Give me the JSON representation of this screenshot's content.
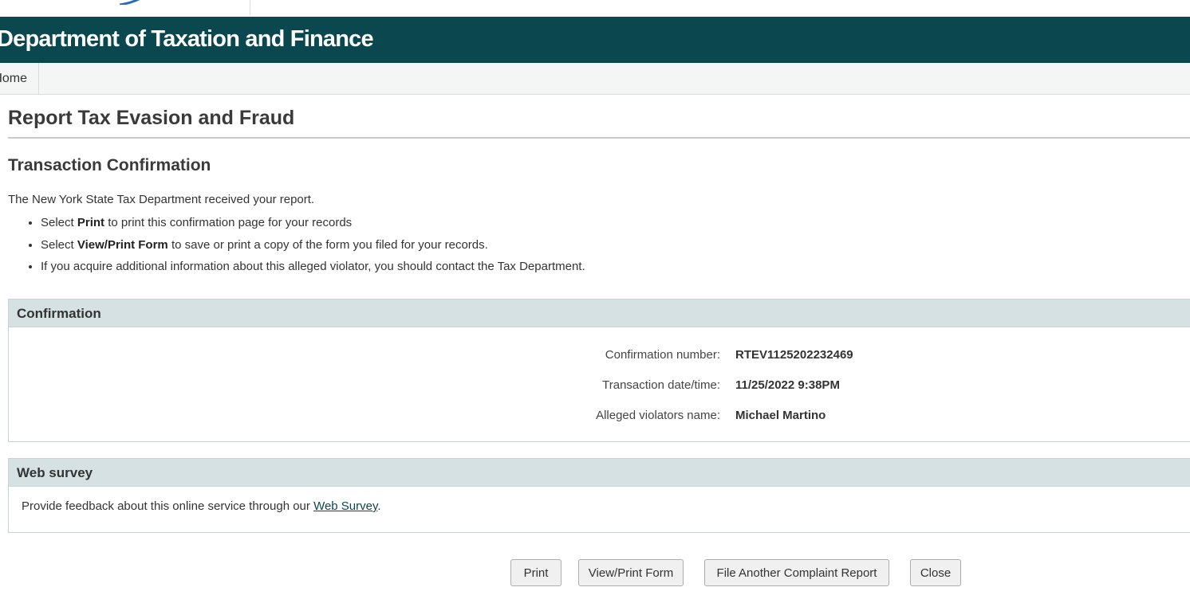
{
  "header": {
    "agency_title": "Department of Taxation and Finance"
  },
  "nav": {
    "home_label": "Home"
  },
  "page": {
    "title": "Report Tax Evasion and Fraud",
    "section_title": "Transaction Confirmation",
    "intro": "The New York State Tax Department received your report.",
    "instructions": [
      {
        "prefix": "Select ",
        "bold": "Print",
        "suffix": " to print this confirmation page for your records"
      },
      {
        "prefix": "Select ",
        "bold": "View/Print Form",
        "suffix": " to save or print a copy of the form you filed for your records."
      },
      {
        "prefix": "",
        "bold": "",
        "suffix": "If you acquire additional information about this alleged violator, you should contact the Tax Department."
      }
    ]
  },
  "confirmation": {
    "heading": "Confirmation",
    "rows": [
      {
        "label": "Confirmation number:",
        "value": "RTEV1125202232469"
      },
      {
        "label": "Transaction date/time:",
        "value": "11/25/2022 9:38PM"
      },
      {
        "label": "Alleged violators name:",
        "value": "Michael Martino"
      }
    ]
  },
  "survey": {
    "heading": "Web survey",
    "text_before": "Provide feedback about this online service through our ",
    "link_label": "Web Survey",
    "text_after": "."
  },
  "buttons": {
    "print": "Print",
    "view_print_form": "View/Print Form",
    "file_another": "File Another Complaint Report",
    "close": "Close"
  },
  "colors": {
    "banner": "#0b474e",
    "panel_header": "#d5e1e2",
    "logo_accent": "#2a6db5"
  }
}
